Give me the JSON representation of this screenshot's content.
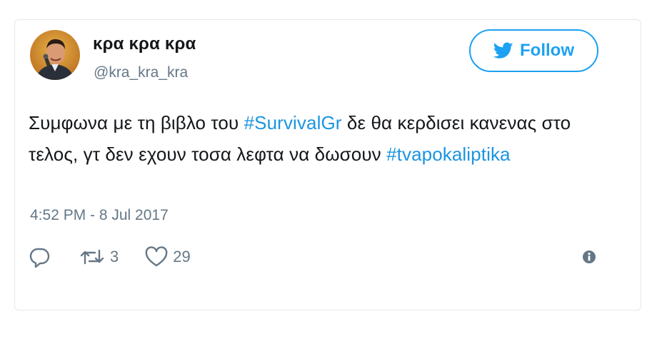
{
  "tweet": {
    "user": {
      "display_name": "κρα κρα κρα",
      "handle": "@kra_kra_kra",
      "avatar_icon": "profile-photo"
    },
    "follow": {
      "label": "Follow",
      "icon": "twitter-bird-icon",
      "color": "#1da1f2"
    },
    "text_parts": {
      "p1": "Συμφωνα με τη βιβλο του ",
      "tag1": "#SurvivalGr",
      "p2": " δε θα κερδισει κανενας στο τελος, γτ δεν εχουν τοσα λεφτα να δωσουν ",
      "tag2": "#tvapokaliptika"
    },
    "timestamp": "4:52 PM - 8 Jul 2017",
    "actions": {
      "reply_icon": "reply-icon",
      "retweet_icon": "retweet-icon",
      "retweet_count": "3",
      "like_icon": "heart-icon",
      "like_count": "29",
      "info_icon": "info-icon"
    },
    "colors": {
      "text": "#14171a",
      "secondary": "#657786",
      "link": "#1b95e0",
      "border": "#e1e8ed"
    }
  }
}
